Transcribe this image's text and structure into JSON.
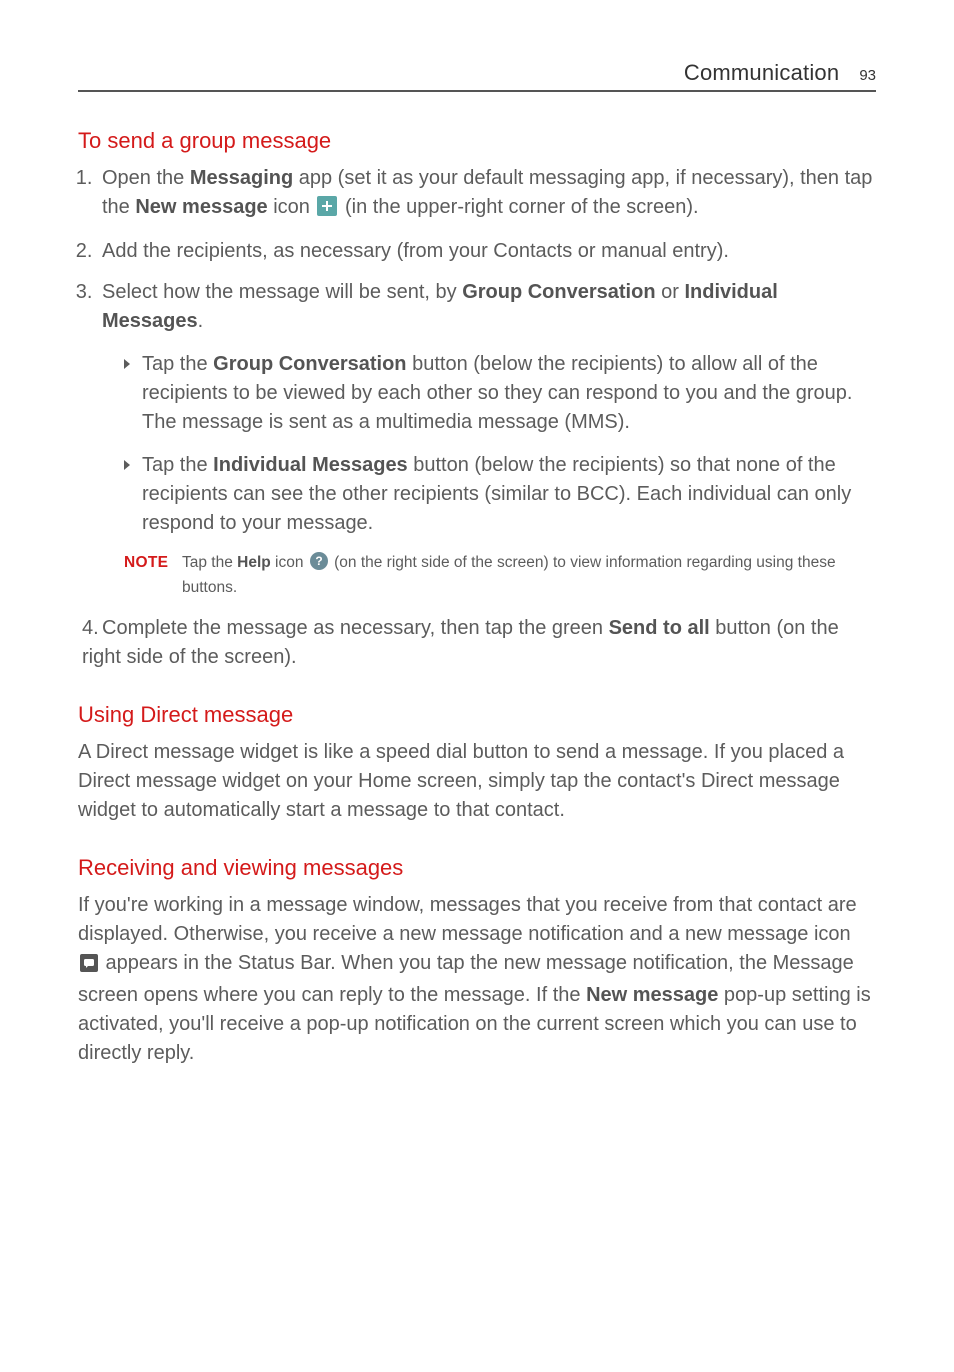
{
  "header": {
    "title": "Communication",
    "page_number": "93"
  },
  "sections": {
    "send_group": {
      "heading": "To send a group message",
      "li1": {
        "p1a": "Open the ",
        "p1b": "Messaging",
        "p1c": " app (set it as your default messaging app, if necessary), then tap the ",
        "p1d": "New message",
        "p1e": " icon ",
        "p1f": " (in the upper-right corner of the screen)."
      },
      "li2": "Add the recipients, as necessary (from your Contacts or manual entry).",
      "li3": {
        "p1a": "Select how the message will be sent, by ",
        "p1b": "Group Conversation",
        "p1c": " or ",
        "p1d": "Individual Messages",
        "p1e": ".",
        "sub1a": "Tap the ",
        "sub1b": "Group Conversation",
        "sub1c": " button (below the recipients) to allow all of the recipients to be viewed by each other so they can respond to you and the group. The message is sent as a multimedia message (MMS).",
        "sub2a": "Tap the ",
        "sub2b": "Individual Messages",
        "sub2c": " button (below the recipients) so that none of the recipients can see the other recipients (similar to BCC). Each individual can only respond to your message."
      },
      "note": {
        "label": "NOTE",
        "t1": "Tap the ",
        "t2": "Help",
        "t3": " icon ",
        "t4": " (on the right side of the screen) to view information regarding using these buttons."
      },
      "li4": {
        "num": "4.",
        "p1a": "Complete the message as necessary, then tap the green ",
        "p1b": "Send to all",
        "p1c": " button (on the right side of the screen)."
      }
    },
    "direct_msg": {
      "heading": "Using Direct message",
      "body": "A Direct message widget is like a speed dial button to send a message. If you placed a Direct message widget on your Home screen, simply tap the contact's Direct message widget to automatically start a message to that contact."
    },
    "receiving": {
      "heading": "Receiving and viewing messages",
      "p1a": "If you're working in a message window, messages that you receive from that contact are displayed. Otherwise, you receive a new message notification and a new message icon ",
      "p1b": " appears in the Status Bar. When you tap the new message notification, the Message screen opens where you can reply to the message. If the ",
      "p1c": "New message",
      "p1d": " pop-up setting is activated, you'll receive a pop-up notification on the current screen which you can use to directly reply."
    }
  }
}
